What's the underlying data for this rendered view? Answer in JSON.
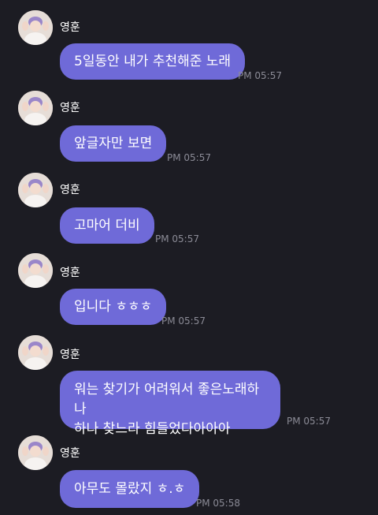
{
  "sender_name": "영훈",
  "messages": [
    {
      "text": "5일동안 내가 추천해준 노래",
      "time": "PM 05:57"
    },
    {
      "text": "앞글자만 보면",
      "time": "PM 05:57"
    },
    {
      "text": "고마어 더비",
      "time": "PM 05:57"
    },
    {
      "text": "입니다 ㅎㅎㅎ",
      "time": "PM 05:57"
    },
    {
      "text": "워는 찾기가 어려워서 좋은노래하나\n하나 찾느라 힘들었다아아아",
      "time": "PM 05:57"
    },
    {
      "text": "아무도 몰랐지 ㅎ.ㅎ",
      "time": "PM 05:58"
    }
  ],
  "colors": {
    "background": "#1c1c23",
    "bubble": "#6f6ad8",
    "timestamp": "#8b8b96",
    "name": "#ffffff"
  },
  "icons": {
    "avatar": "profile-photo"
  }
}
